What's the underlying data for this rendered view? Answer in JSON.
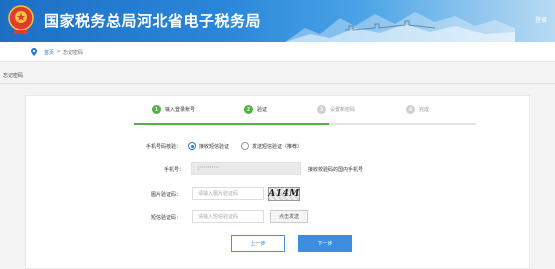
{
  "header": {
    "site_title": "国家税务总局河北省电子税务局",
    "login_link": "登录"
  },
  "breadcrumb": {
    "home": "首页",
    "separator": ">",
    "current": "忘记密码"
  },
  "page_heading": "忘记密码",
  "steps": [
    {
      "num": "1",
      "label": "输入登录账号",
      "state": "done"
    },
    {
      "num": "2",
      "label": "验证",
      "state": "done"
    },
    {
      "num": "3",
      "label": "设置新密码",
      "state": "todo"
    },
    {
      "num": "4",
      "label": "完成",
      "state": "todo"
    }
  ],
  "form": {
    "method_label": "手机号码核验：",
    "method_options": [
      {
        "label": "接收短信验证",
        "checked": true
      },
      {
        "label": "发送短信验证（推荐）",
        "checked": false
      }
    ],
    "phone_label": "手机号：",
    "phone_value": "1**********",
    "phone_hint": "接收校验码的国内手机号",
    "image_code_label": "图片验证码：",
    "image_code_placeholder": "请输入图片验证码",
    "captcha_text": "A14M",
    "sms_code_label": "短信验证码：",
    "sms_code_placeholder": "请输入短信验证码",
    "send_button": "点击发送"
  },
  "buttons": {
    "prev": "上一步",
    "next": "下一步"
  },
  "colors": {
    "primary": "#2a7bd5",
    "step_done": "#52b344",
    "step_todo": "#cfcfcf"
  }
}
